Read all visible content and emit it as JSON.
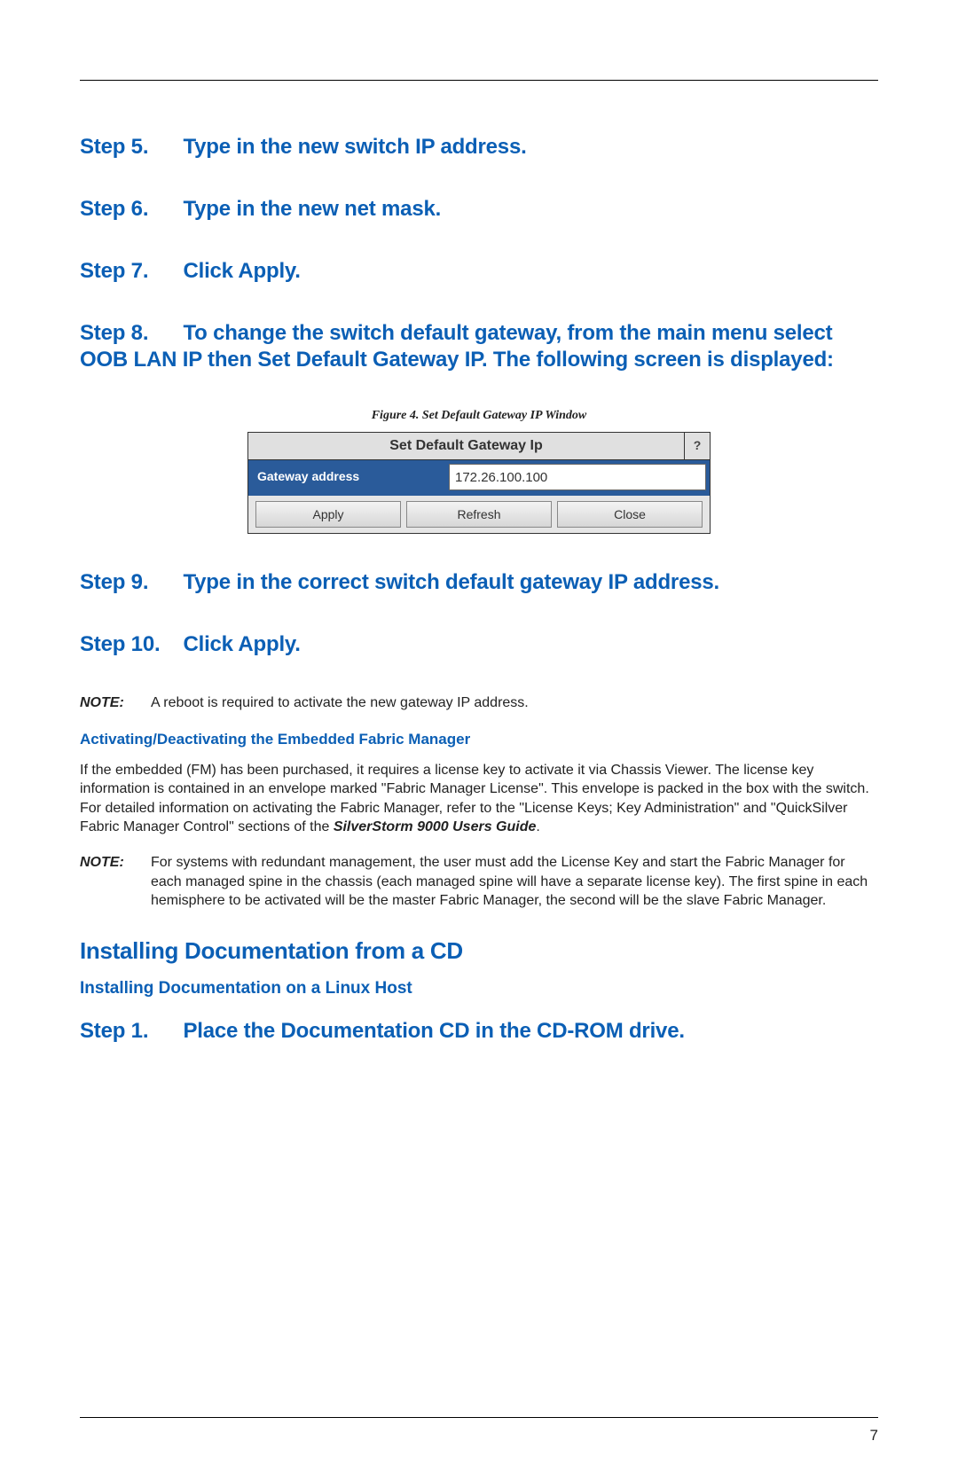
{
  "steps": {
    "s5_label": "Step 5.",
    "s5_text": "Type in the new switch IP address.",
    "s6_label": "Step 6.",
    "s6_text": "Type in the new net mask.",
    "s7_label": "Step 7.",
    "s7_text": "Click Apply.",
    "s8_label": "Step 8.",
    "s8_text": "To change the switch default gateway, from the main menu select OOB LAN IP then Set Default Gateway IP. The following screen is displayed:",
    "s9_label": "Step 9.",
    "s9_text": "Type in the correct switch default gateway IP address.",
    "s10_label": "Step 10.",
    "s10_text": "Click Apply.",
    "s1b_label": "Step 1.",
    "s1b_text": "Place the Documentation CD in the CD-ROM drive."
  },
  "figure": {
    "caption": "Figure 4. Set Default Gateway IP Window",
    "dialog_title": "Set Default Gateway Ip",
    "help_symbol": "?",
    "label_gateway": "Gateway address",
    "input_value": "172.26.100.100",
    "btn_apply": "Apply",
    "btn_refresh": "Refresh",
    "btn_close": "Close"
  },
  "notes": {
    "note_label": "NOTE:",
    "note1_body": "A reboot is required to activate the new gateway IP address.",
    "note2_body": "For systems with redundant management, the user must add the License Key and start the Fabric Manager for each managed spine in the chassis (each managed spine will have a separate license key). The first spine in each hemisphere to be activated will be the master Fabric Manager, the second will be the slave Fabric Manager."
  },
  "headings": {
    "activating": "Activating/Deactivating the Embedded Fabric Manager",
    "install_cd": "Installing Documentation from a CD",
    "install_linux": "Installing Documentation on a Linux Host"
  },
  "body": {
    "fm_para_part1": "If the embedded (FM) has been purchased, it requires a license key to activate it via Chassis Viewer. The license key information is contained in an envelope marked \"Fabric Manager License\". This envelope is packed in the box with the switch. For detailed information on activating the Fabric Manager, refer to the \"License Keys; Key Administration\" and \"QuickSilver Fabric Manager Control\" sections of the ",
    "fm_para_guide": "SilverStorm 9000 Users Guide",
    "fm_para_part2": "."
  },
  "page_number": "7"
}
